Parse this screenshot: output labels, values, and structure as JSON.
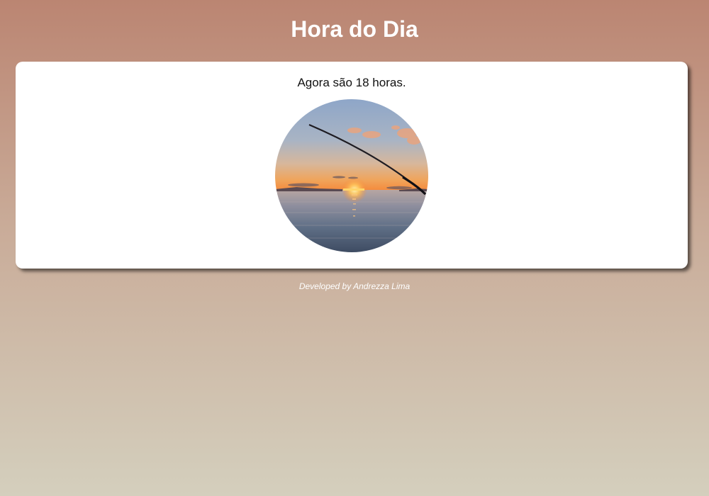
{
  "header": {
    "title": "Hora do Dia"
  },
  "main": {
    "message": "Agora são 18 horas.",
    "image_subject": "sunset-over-sea-with-fishing-rod"
  },
  "footer": {
    "credit": "Developed by Andrezza Lima"
  },
  "colors": {
    "background_top": "#bb8572",
    "background_bottom": "#d4cfbd",
    "card": "#ffffff",
    "title_text": "#ffffff",
    "body_text": "#111111"
  }
}
